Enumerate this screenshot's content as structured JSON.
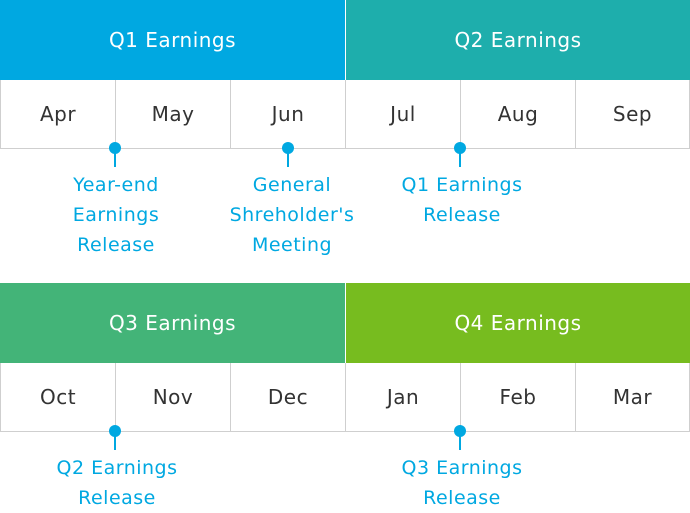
{
  "rows": [
    {
      "quarters": [
        {
          "label": "Q1 Earnings",
          "color": "#00a8e1"
        },
        {
          "label": "Q2 Earnings",
          "color": "#1eaeac"
        }
      ],
      "months": [
        "Apr",
        "May",
        "Jun",
        "Jul",
        "Aug",
        "Sep"
      ],
      "events": [
        {
          "lines": [
            "Year-end",
            "Earnings",
            "Release"
          ]
        },
        {
          "lines": [
            "General",
            "Shreholder's",
            "Meeting"
          ]
        },
        {
          "lines": [
            "Q1 Earnings",
            "Release"
          ]
        }
      ]
    },
    {
      "quarters": [
        {
          "label": "Q3 Earnings",
          "color": "#43b478"
        },
        {
          "label": "Q4 Earnings",
          "color": "#77bc1f"
        }
      ],
      "months": [
        "Oct",
        "Nov",
        "Dec",
        "Jan",
        "Feb",
        "Mar"
      ],
      "events": [
        {
          "lines": [
            "Q2 Earnings",
            "Release"
          ]
        },
        {
          "lines": [
            "Q3 Earnings",
            "Release"
          ]
        }
      ]
    }
  ],
  "colors": {
    "marker": "#00a8e1",
    "event_text": "#00a8e1",
    "month_text": "#333333",
    "grid": "#cfcfcf"
  }
}
